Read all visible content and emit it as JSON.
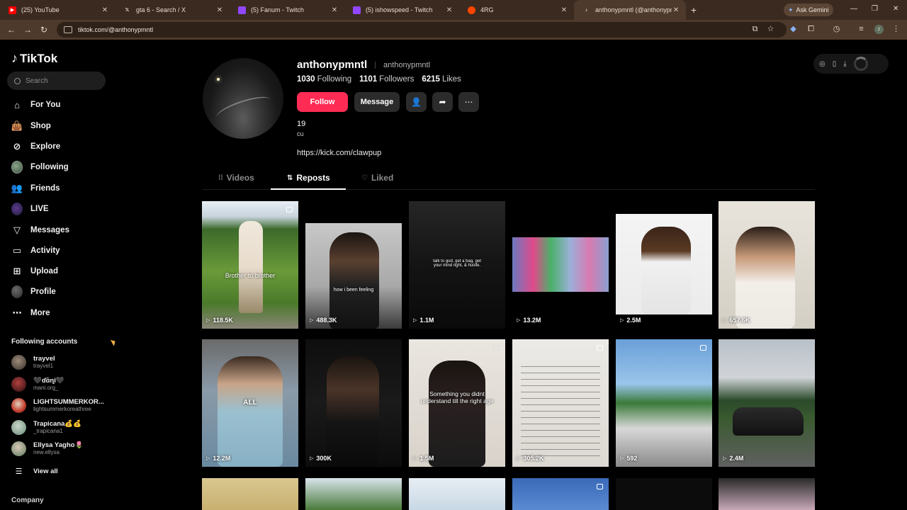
{
  "browser": {
    "tabs": [
      {
        "title": "(25) YouTube",
        "icon": "youtube-icon",
        "color": "#ff0000"
      },
      {
        "title": "gta 6 - Search / X",
        "icon": "x-icon",
        "color": "#000000"
      },
      {
        "title": "(5) Fanum - Twitch",
        "icon": "twitch-icon",
        "color": "#9146ff"
      },
      {
        "title": "(5) ishowspeed - Twitch",
        "icon": "twitch-icon",
        "color": "#9146ff"
      },
      {
        "title": "4RG",
        "icon": "reddit-icon",
        "color": "#ff4500"
      },
      {
        "title": "anthonypmntl (@anthonypmnt",
        "icon": "tiktok-icon",
        "color": "#000000"
      }
    ],
    "gemini_label": "Ask Gemini",
    "url": "tiktok.com/@anthonypmntl"
  },
  "sidebar": {
    "logo": "TikTok",
    "search_placeholder": "Search",
    "items": [
      {
        "label": "For You",
        "icon": "home-icon"
      },
      {
        "label": "Shop",
        "icon": "shopping-bag-icon"
      },
      {
        "label": "Explore",
        "icon": "compass-icon"
      },
      {
        "label": "Following",
        "icon": "following-avatar-icon"
      },
      {
        "label": "Friends",
        "icon": "friends-icon"
      },
      {
        "label": "LIVE",
        "icon": "live-icon"
      },
      {
        "label": "Messages",
        "icon": "paper-plane-icon"
      },
      {
        "label": "Activity",
        "icon": "activity-icon"
      },
      {
        "label": "Upload",
        "icon": "plus-square-icon"
      },
      {
        "label": "Profile",
        "icon": "profile-avatar-icon"
      },
      {
        "label": "More",
        "icon": "more-dots-icon"
      }
    ],
    "following_title": "Following accounts",
    "accounts": [
      {
        "name": "trayvel",
        "handle": "trayvel1",
        "color": "#7a6a5a"
      },
      {
        "name": "🖤ɗɑ̃ɳi🖤",
        "handle": "mani.org_",
        "color": "#8a2a2a"
      },
      {
        "name": "LIGHTSUMMERKOR...",
        "handle": "lightsummerkoreathree",
        "color": "#c43a2a"
      },
      {
        "name": "Trapicana💰💰",
        "handle": "_trapicana1",
        "color": "#9ab0a0"
      },
      {
        "name": "Ellysa Yagho🌷",
        "handle": "new.ellysa",
        "color": "#6a8a6a"
      }
    ],
    "view_all": "View all",
    "company": "Company"
  },
  "profile": {
    "username": "anthonypmntl",
    "nickname": "anthonypmntl",
    "following_count": "1030",
    "following_label": "Following",
    "followers_count": "1101",
    "followers_label": "Followers",
    "likes_count": "6215",
    "likes_label": "Likes",
    "follow_label": "Follow",
    "message_label": "Message",
    "bio_line1": "19",
    "bio_line2": "cu",
    "link": "https://kick.com/clawpup"
  },
  "content_tabs": [
    {
      "label": "Videos",
      "icon": "grid-icon",
      "active": false
    },
    {
      "label": "Reposts",
      "icon": "repost-icon",
      "active": true
    },
    {
      "label": "Liked",
      "icon": "heart-icon",
      "active": false
    }
  ],
  "videos": [
    {
      "views": "118.5K",
      "caption": "Brother to brother"
    },
    {
      "views": "488.3K",
      "caption": "how i been feeling"
    },
    {
      "views": "1.1M",
      "caption": "talk to god, get a bag, get your mind right, & hustle."
    },
    {
      "views": "13.2M",
      "caption": ""
    },
    {
      "views": "2.5M",
      "caption": ""
    },
    {
      "views": "657.6K",
      "caption": ""
    },
    {
      "views": "12.2M",
      "caption": "ALL"
    },
    {
      "views": "300K",
      "caption": ""
    },
    {
      "views": "1.5M",
      "caption": "Something you didnt understand till the right age"
    },
    {
      "views": "305.2K",
      "caption": ""
    },
    {
      "views": "592",
      "caption": ""
    },
    {
      "views": "2.4M",
      "caption": ""
    }
  ]
}
